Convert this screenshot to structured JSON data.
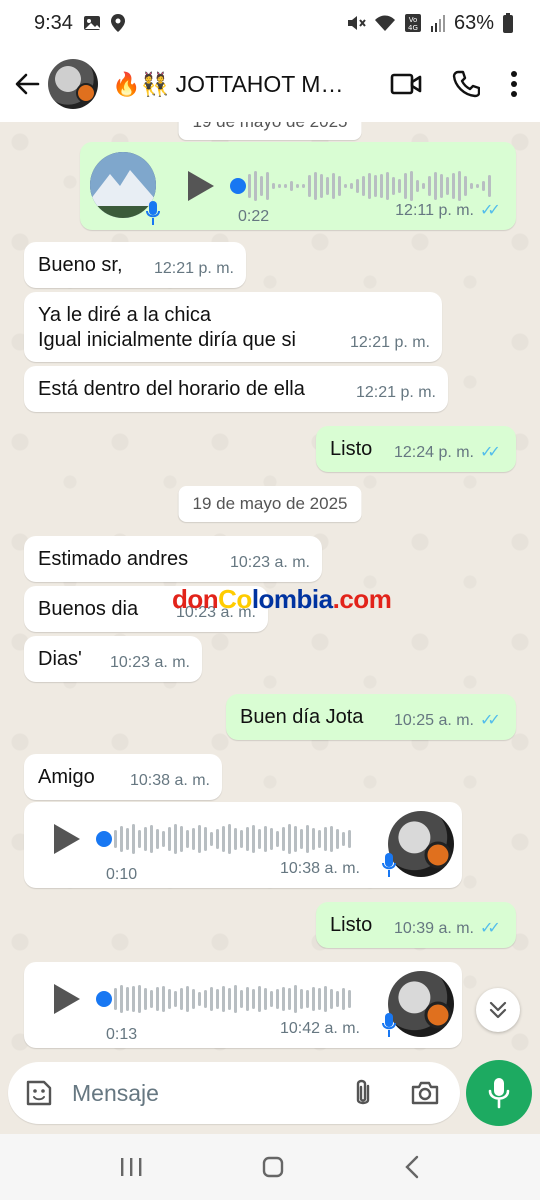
{
  "status_bar": {
    "time": "9:34",
    "battery": "63%"
  },
  "header": {
    "title": "🔥👯 JOTTAHOT MA...",
    "accent": "#1daa61"
  },
  "date_pills": {
    "partial": "19 de mayo de 2025",
    "second": "19 de mayo de 2025"
  },
  "messages": [
    {
      "dir": "out",
      "type": "voice",
      "duration": "0:22",
      "time": "12:11 p. m."
    },
    {
      "dir": "in",
      "text": "Bueno sr,",
      "time": "12:21 p. m."
    },
    {
      "dir": "in",
      "lines": [
        "Ya le diré a la chica",
        "Igual inicialmente diría que si"
      ],
      "time": "12:21 p. m."
    },
    {
      "dir": "in",
      "text": "Está dentro del horario de ella",
      "time": "12:21 p. m."
    },
    {
      "dir": "out",
      "text": "Listo",
      "time": "12:24 p. m."
    },
    {
      "dir": "in",
      "text": "Estimado andres",
      "time": "10:23 a. m."
    },
    {
      "dir": "in",
      "text": "Buenos dia",
      "time": "10:23 a. m."
    },
    {
      "dir": "in",
      "text": "Dias'",
      "time": "10:23 a. m."
    },
    {
      "dir": "out",
      "text": "Buen día Jota",
      "time": "10:25 a. m."
    },
    {
      "dir": "in",
      "text": "Amigo",
      "time": "10:38 a. m."
    },
    {
      "dir": "in",
      "type": "voice",
      "duration": "0:10",
      "time": "10:38 a. m."
    },
    {
      "dir": "out",
      "text": "Listo",
      "time": "10:39 a. m."
    },
    {
      "dir": "in",
      "type": "voice",
      "duration": "0:13",
      "time": "10:42 a. m."
    }
  ],
  "watermark": {
    "part1": "don",
    "part2": "Co",
    "part3": "lombia",
    "part4": ".com"
  },
  "composer": {
    "placeholder": "Mensaje"
  },
  "icons": {
    "back": "arrow-left-icon",
    "video": "video-camera-icon",
    "call": "phone-icon",
    "menu": "more-vertical-icon",
    "emoji": "sticker-icon",
    "attach": "paperclip-icon",
    "camera": "camera-icon",
    "mic": "microphone-icon",
    "scroll": "double-chevron-down-icon"
  }
}
